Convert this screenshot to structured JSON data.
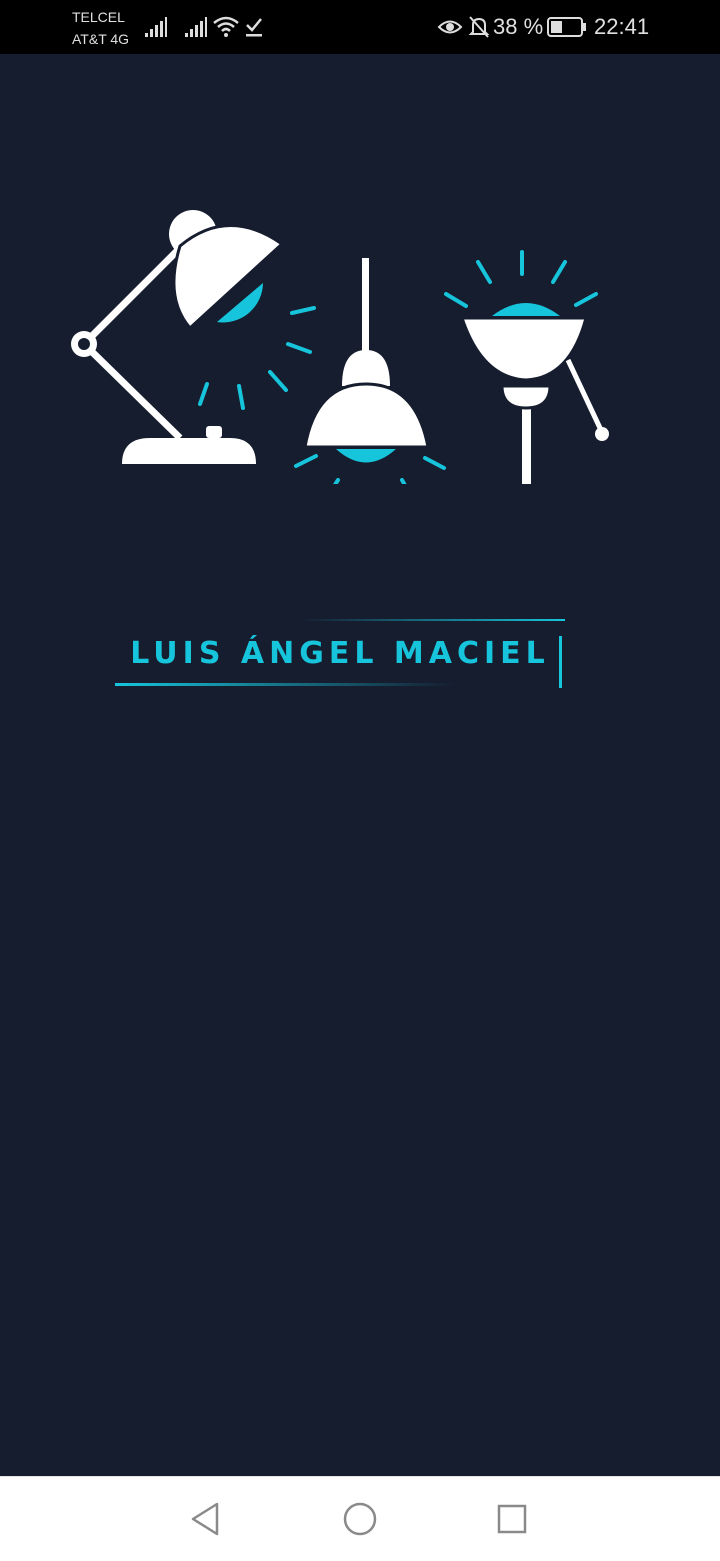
{
  "status_bar": {
    "carrier_1": "TELCEL",
    "carrier_2": "AT&T 4G",
    "battery_percent": "38 %",
    "time": "22:41",
    "icons": [
      "signal-icon",
      "signal-icon",
      "wifi-icon",
      "download-done-icon",
      "eye-comfort-icon",
      "notifications-off-icon",
      "battery-icon"
    ]
  },
  "app": {
    "title": "LUIS ÁNGEL MACIEL",
    "background_color": "#161d2f",
    "accent_color": "#16c5dc",
    "illustration": [
      "desk-lamp-icon",
      "pendant-lamp-icon",
      "table-lamp-icon"
    ]
  },
  "nav_bar": {
    "buttons": [
      "back-icon",
      "home-icon",
      "recents-icon"
    ]
  }
}
